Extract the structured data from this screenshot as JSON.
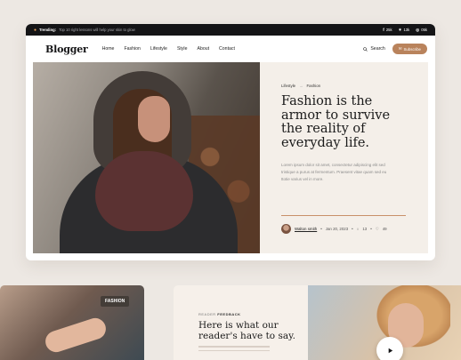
{
  "topbar": {
    "trending_label": "Trending:",
    "trending_text": "Top 10 right lessons will help your skin to glow",
    "socials": [
      {
        "icon": "facebook-icon",
        "glyph": "f",
        "count": "25k"
      },
      {
        "icon": "twitter-icon",
        "glyph": "✶",
        "count": "13k"
      },
      {
        "icon": "instagram-icon",
        "glyph": "◎",
        "count": "05k"
      }
    ]
  },
  "nav": {
    "logo": "Blogger",
    "menu": [
      "Home",
      "Fashion",
      "Lifestyle",
      "Style",
      "About",
      "Contact"
    ],
    "search_label": "Search",
    "subscribe_label": "Subscribe"
  },
  "hero": {
    "breadcrumb": [
      "Lifestyle",
      "Fashion"
    ],
    "headline": "Fashion is the armor to survive the reality of everyday life.",
    "excerpt": "Lorem ipsum dolor sit amet, consectetur adipiscing elit sed tristique a purus at fermentum. Praesent vitae quam sed eu ttotie varius vel in more.",
    "author": "Walton smith",
    "date": "Jan 20, 2023",
    "comments": "13",
    "likes": "49"
  },
  "cards": {
    "fashion_tag": "FASHION",
    "feedback_kicker": "READER",
    "feedback_kicker_bold": "FEEDBACK",
    "feedback_title": "Here is what our reader's have to say."
  },
  "colors": {
    "accent": "#b9835c",
    "topbar_bg": "#141416",
    "page_bg": "#ede8e3"
  }
}
